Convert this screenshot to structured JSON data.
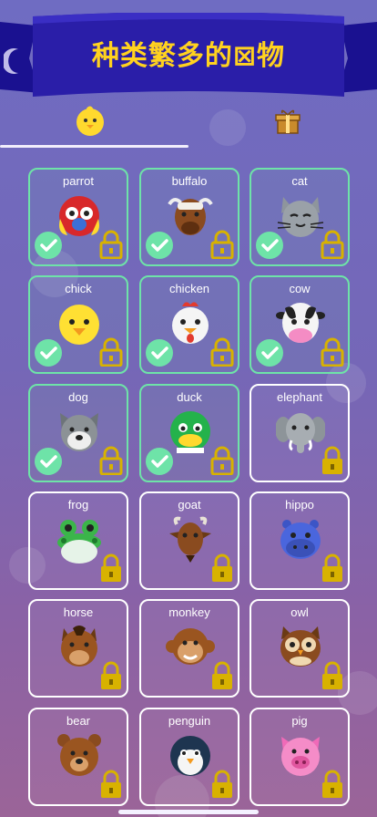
{
  "header": {
    "title": "种类繁多的⊠物",
    "banner_color": "#2a1ea8",
    "title_color": "#ffd21f"
  },
  "progress": {
    "fraction": 0.5
  },
  "colors": {
    "done_border": "#6ee3a8",
    "check": "#6ee3a8",
    "lock": "#d8b200",
    "card_border": "#ffffff"
  },
  "animals": [
    {
      "label": "parrot",
      "icon": "parrot-icon",
      "completed": true
    },
    {
      "label": "buffalo",
      "icon": "buffalo-icon",
      "completed": true
    },
    {
      "label": "cat",
      "icon": "cat-icon",
      "completed": true
    },
    {
      "label": "chick",
      "icon": "chick-icon",
      "completed": true
    },
    {
      "label": "chicken",
      "icon": "chicken-icon",
      "completed": true
    },
    {
      "label": "cow",
      "icon": "cow-icon",
      "completed": true
    },
    {
      "label": "dog",
      "icon": "dog-icon",
      "completed": true
    },
    {
      "label": "duck",
      "icon": "duck-icon",
      "completed": true
    },
    {
      "label": "elephant",
      "icon": "elephant-icon",
      "completed": false
    },
    {
      "label": "frog",
      "icon": "frog-icon",
      "completed": false
    },
    {
      "label": "goat",
      "icon": "goat-icon",
      "completed": false
    },
    {
      "label": "hippo",
      "icon": "hippo-icon",
      "completed": false
    },
    {
      "label": "horse",
      "icon": "horse-icon",
      "completed": false
    },
    {
      "label": "monkey",
      "icon": "monkey-icon",
      "completed": false
    },
    {
      "label": "owl",
      "icon": "owl-icon",
      "completed": false
    },
    {
      "label": "bear",
      "icon": "bear-icon",
      "completed": false
    },
    {
      "label": "penguin",
      "icon": "penguin-icon",
      "completed": false
    },
    {
      "label": "pig",
      "icon": "pig-icon",
      "completed": false
    }
  ]
}
